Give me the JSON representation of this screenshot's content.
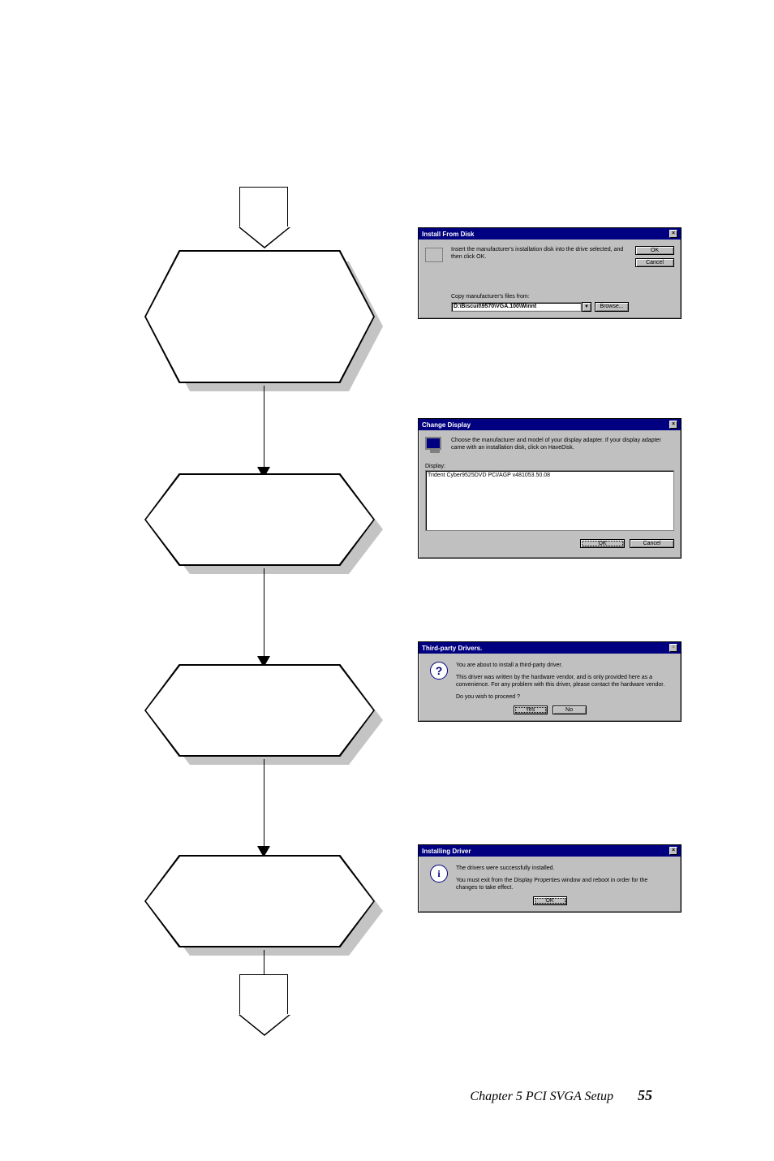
{
  "flow": {
    "connector_in": "",
    "connector_out": ""
  },
  "dialog_install": {
    "title": "Install From Disk",
    "text": "Insert the manufacturer's installation disk into the drive selected, and then click OK.",
    "ok": "OK",
    "cancel": "Cancel",
    "copy_label": "Copy manufacturer's files from:",
    "path_value": "D:\\Biscuit\\9570\\VGA.100\\Winnt",
    "browse": "Browse..."
  },
  "dialog_change": {
    "title": "Change Display",
    "text": "Choose the manufacturer and model of your display adapter. If your display adapter came with an installation disk, click on HaveDisk.",
    "display_label": "Display:",
    "list_item": "Trident Cyber9525DVD PCI/AGP v481053.50.08",
    "ok": "OK",
    "cancel": "Cancel"
  },
  "dialog_third": {
    "title": "Third-party Drivers.",
    "line1": "You are about to install a third-party driver.",
    "line2": "This driver was written by the hardware vendor, and is only provided here as a convenience.  For any problem with this driver, please contact the hardware vendor.",
    "line3": "Do you wish to proceed ?",
    "yes": "Yes",
    "no": "No"
  },
  "dialog_driver": {
    "title": "Installing Driver",
    "line1": "The drivers were successfully installed.",
    "line2": "You must exit from the Display Properties window and reboot in order for the changes to take effect.",
    "ok": "OK"
  },
  "footer": {
    "chapter": "Chapter 5  PCI SVGA Setup",
    "page": "55"
  }
}
